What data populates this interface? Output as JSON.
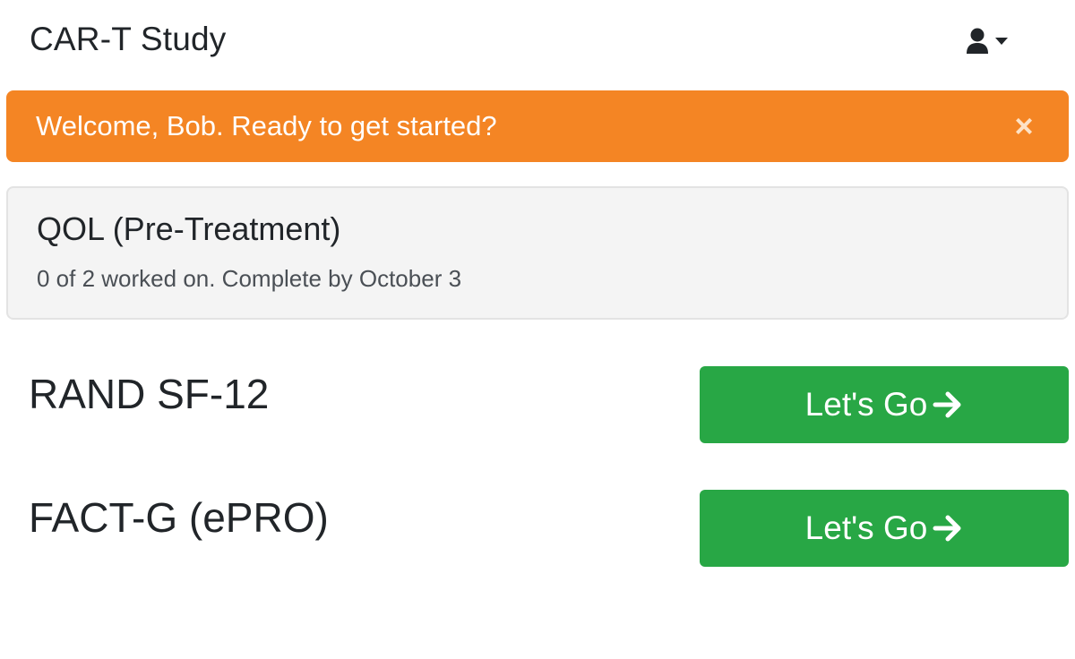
{
  "navbar": {
    "brand": "CAR-T Study",
    "user_icon": "user-icon",
    "caret_icon": "caret-down-icon"
  },
  "alert": {
    "message": "Welcome, Bob. Ready to get started?",
    "close_label": "×",
    "color": "#f48524"
  },
  "card": {
    "title": "QOL (Pre-Treatment)",
    "subtitle": "0 of 2 worked on. Complete by October 3"
  },
  "surveys": [
    {
      "name": "RAND SF-12",
      "button_label": "Let's Go",
      "button_icon": "arrow-right-icon"
    },
    {
      "name": "FACT-G (ePRO)",
      "button_label": "Let's Go",
      "button_icon": "arrow-right-icon"
    }
  ],
  "colors": {
    "accent": "#f48524",
    "success": "#28a745",
    "text": "#212529"
  }
}
